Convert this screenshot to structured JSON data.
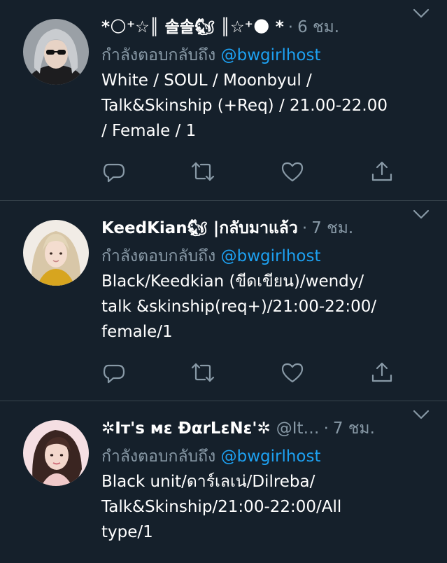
{
  "reply_prefix": "กำลังตอบกลับถึง",
  "colors": {
    "background": "#15202b",
    "divider": "#38444d",
    "secondary_text": "#8899a6",
    "accent": "#1da1f2"
  },
  "tweets": [
    {
      "name": "*🌕⁺☆║ 솔솔🐿 ║☆⁺🌑 *",
      "handle": "",
      "dot": "·",
      "time": "6 ชม.",
      "reply_to": "@bwgirlhost",
      "text": "White / SOUL / Moonbyul /\nTalk&Skinship (+Req) / 21.00-22.00\n/ Female / 1",
      "avatar": "avatar-gray-hair-sunglasses"
    },
    {
      "name": "KeedKian🐿 |กลับมาแล้ว",
      "handle": "",
      "dot": "·",
      "time": "7 ชม.",
      "reply_to": "@bwgirlhost",
      "text": "Black/Keedkian (ขีดเขียน)/wendy/\ntalk &skinship(req+)/21:00-22:00/\nfemale/1",
      "avatar": "avatar-blonde-yellow-jacket"
    },
    {
      "name": "✲Iт's мε ĐαrLεNε'✲",
      "handle": "@It…",
      "dot": "·",
      "time": "7 ชม.",
      "reply_to": "@bwgirlhost",
      "text": "Black unit/ดาร์เลเน่/Dilreba/\nTalk&Skinship/21:00-22:00/All\ntype/1",
      "avatar": "avatar-dark-hair-pink"
    }
  ],
  "actions": [
    "reply-icon",
    "retweet-icon",
    "like-icon",
    "share-icon"
  ]
}
